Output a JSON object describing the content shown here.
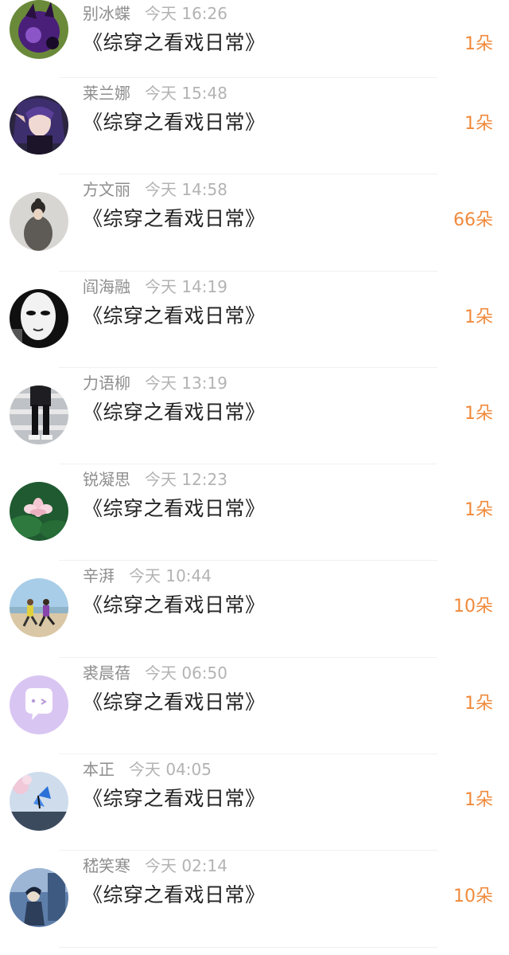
{
  "items": [
    {
      "name": "别冰蝶",
      "time": "今天 16:26",
      "title": "《综穿之看戏日常》",
      "count": "1朵"
    },
    {
      "name": "莱兰娜",
      "time": "今天 15:48",
      "title": "《综穿之看戏日常》",
      "count": "1朵"
    },
    {
      "name": "方文丽",
      "time": "今天 14:58",
      "title": "《综穿之看戏日常》",
      "count": "66朵"
    },
    {
      "name": "阎海融",
      "time": "今天 14:19",
      "title": "《综穿之看戏日常》",
      "count": "1朵"
    },
    {
      "name": "力语柳",
      "time": "今天 13:19",
      "title": "《综穿之看戏日常》",
      "count": "1朵"
    },
    {
      "name": "锐凝思",
      "time": "今天 12:23",
      "title": "《综穿之看戏日常》",
      "count": "1朵"
    },
    {
      "name": "辛湃",
      "time": "今天 10:44",
      "title": "《综穿之看戏日常》",
      "count": "10朵"
    },
    {
      "name": "裘晨蓓",
      "time": "今天 06:50",
      "title": "《综穿之看戏日常》",
      "count": "1朵"
    },
    {
      "name": "本正",
      "time": "今天 04:05",
      "title": "《综穿之看戏日常》",
      "count": "1朵"
    },
    {
      "name": "嵇笑寒",
      "time": "今天 02:14",
      "title": "《综穿之看戏日常》",
      "count": "10朵"
    }
  ],
  "colors": {
    "count": "#f08a3c",
    "title": "#222222",
    "name": "#8e8e8e",
    "time": "#b3b3b3"
  }
}
